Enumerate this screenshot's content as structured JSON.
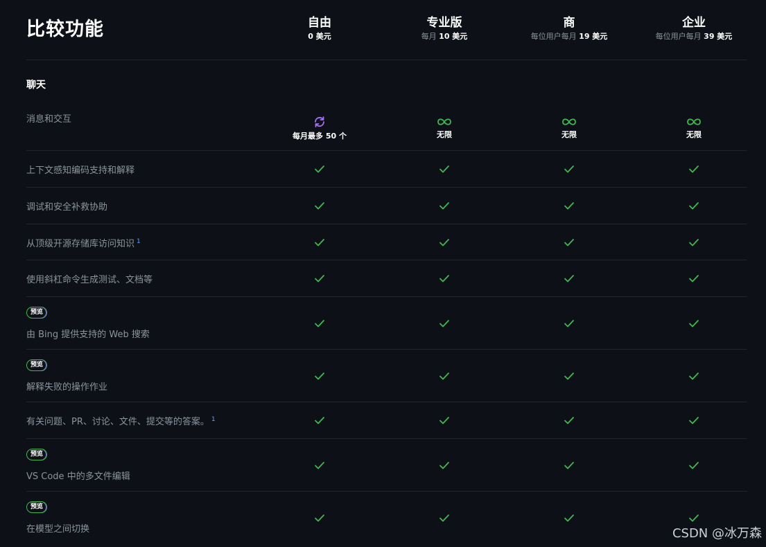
{
  "header": {
    "title": "比较功能",
    "plans": [
      {
        "name": "自由",
        "price_prefix": "",
        "price_amount": "0 美元"
      },
      {
        "name": "专业版",
        "price_prefix": "每月",
        "price_amount": "10 美元"
      },
      {
        "name": "商",
        "price_prefix": "每位用户每月",
        "price_amount": "19 美元"
      },
      {
        "name": "企业",
        "price_prefix": "每位用户每月",
        "price_amount": "39 美元"
      }
    ]
  },
  "section": {
    "title": "聊天"
  },
  "badge_label": "预览",
  "rows": [
    {
      "feature": "消息和交互",
      "footnote": "",
      "badge": false,
      "cells": [
        {
          "icon": "refresh-icon",
          "label": "每月最多 50 个"
        },
        {
          "icon": "infinity-icon",
          "label": "无限"
        },
        {
          "icon": "infinity-icon",
          "label": "无限"
        },
        {
          "icon": "infinity-icon",
          "label": "无限"
        }
      ]
    },
    {
      "feature": "上下文感知编码支持和解释",
      "footnote": "",
      "badge": false
    },
    {
      "feature": "调试和安全补救协助",
      "footnote": "",
      "badge": false
    },
    {
      "feature": "从顶级开源存储库访问知识",
      "footnote": "1",
      "badge": false
    },
    {
      "feature": "使用斜杠命令生成测试、文档等",
      "footnote": "",
      "badge": false
    },
    {
      "feature": "由 Bing 提供支持的 Web 搜索",
      "footnote": "",
      "badge": true
    },
    {
      "feature": "解释失败的操作作业",
      "footnote": "",
      "badge": true
    },
    {
      "feature": "有关问题、PR、讨论、文件、提交等的答案。",
      "footnote": "1",
      "badge": false
    },
    {
      "feature": "VS Code 中的多文件编辑",
      "footnote": "",
      "badge": true
    },
    {
      "feature": "在模型之间切换",
      "footnote": "",
      "badge": true
    }
  ],
  "watermark": "CSDN @冰万森",
  "colors": {
    "background": "#0d1117",
    "check": "#3fb950",
    "refresh": "#a371f7",
    "divider": "#21262d",
    "feature_text": "#8b949e"
  }
}
